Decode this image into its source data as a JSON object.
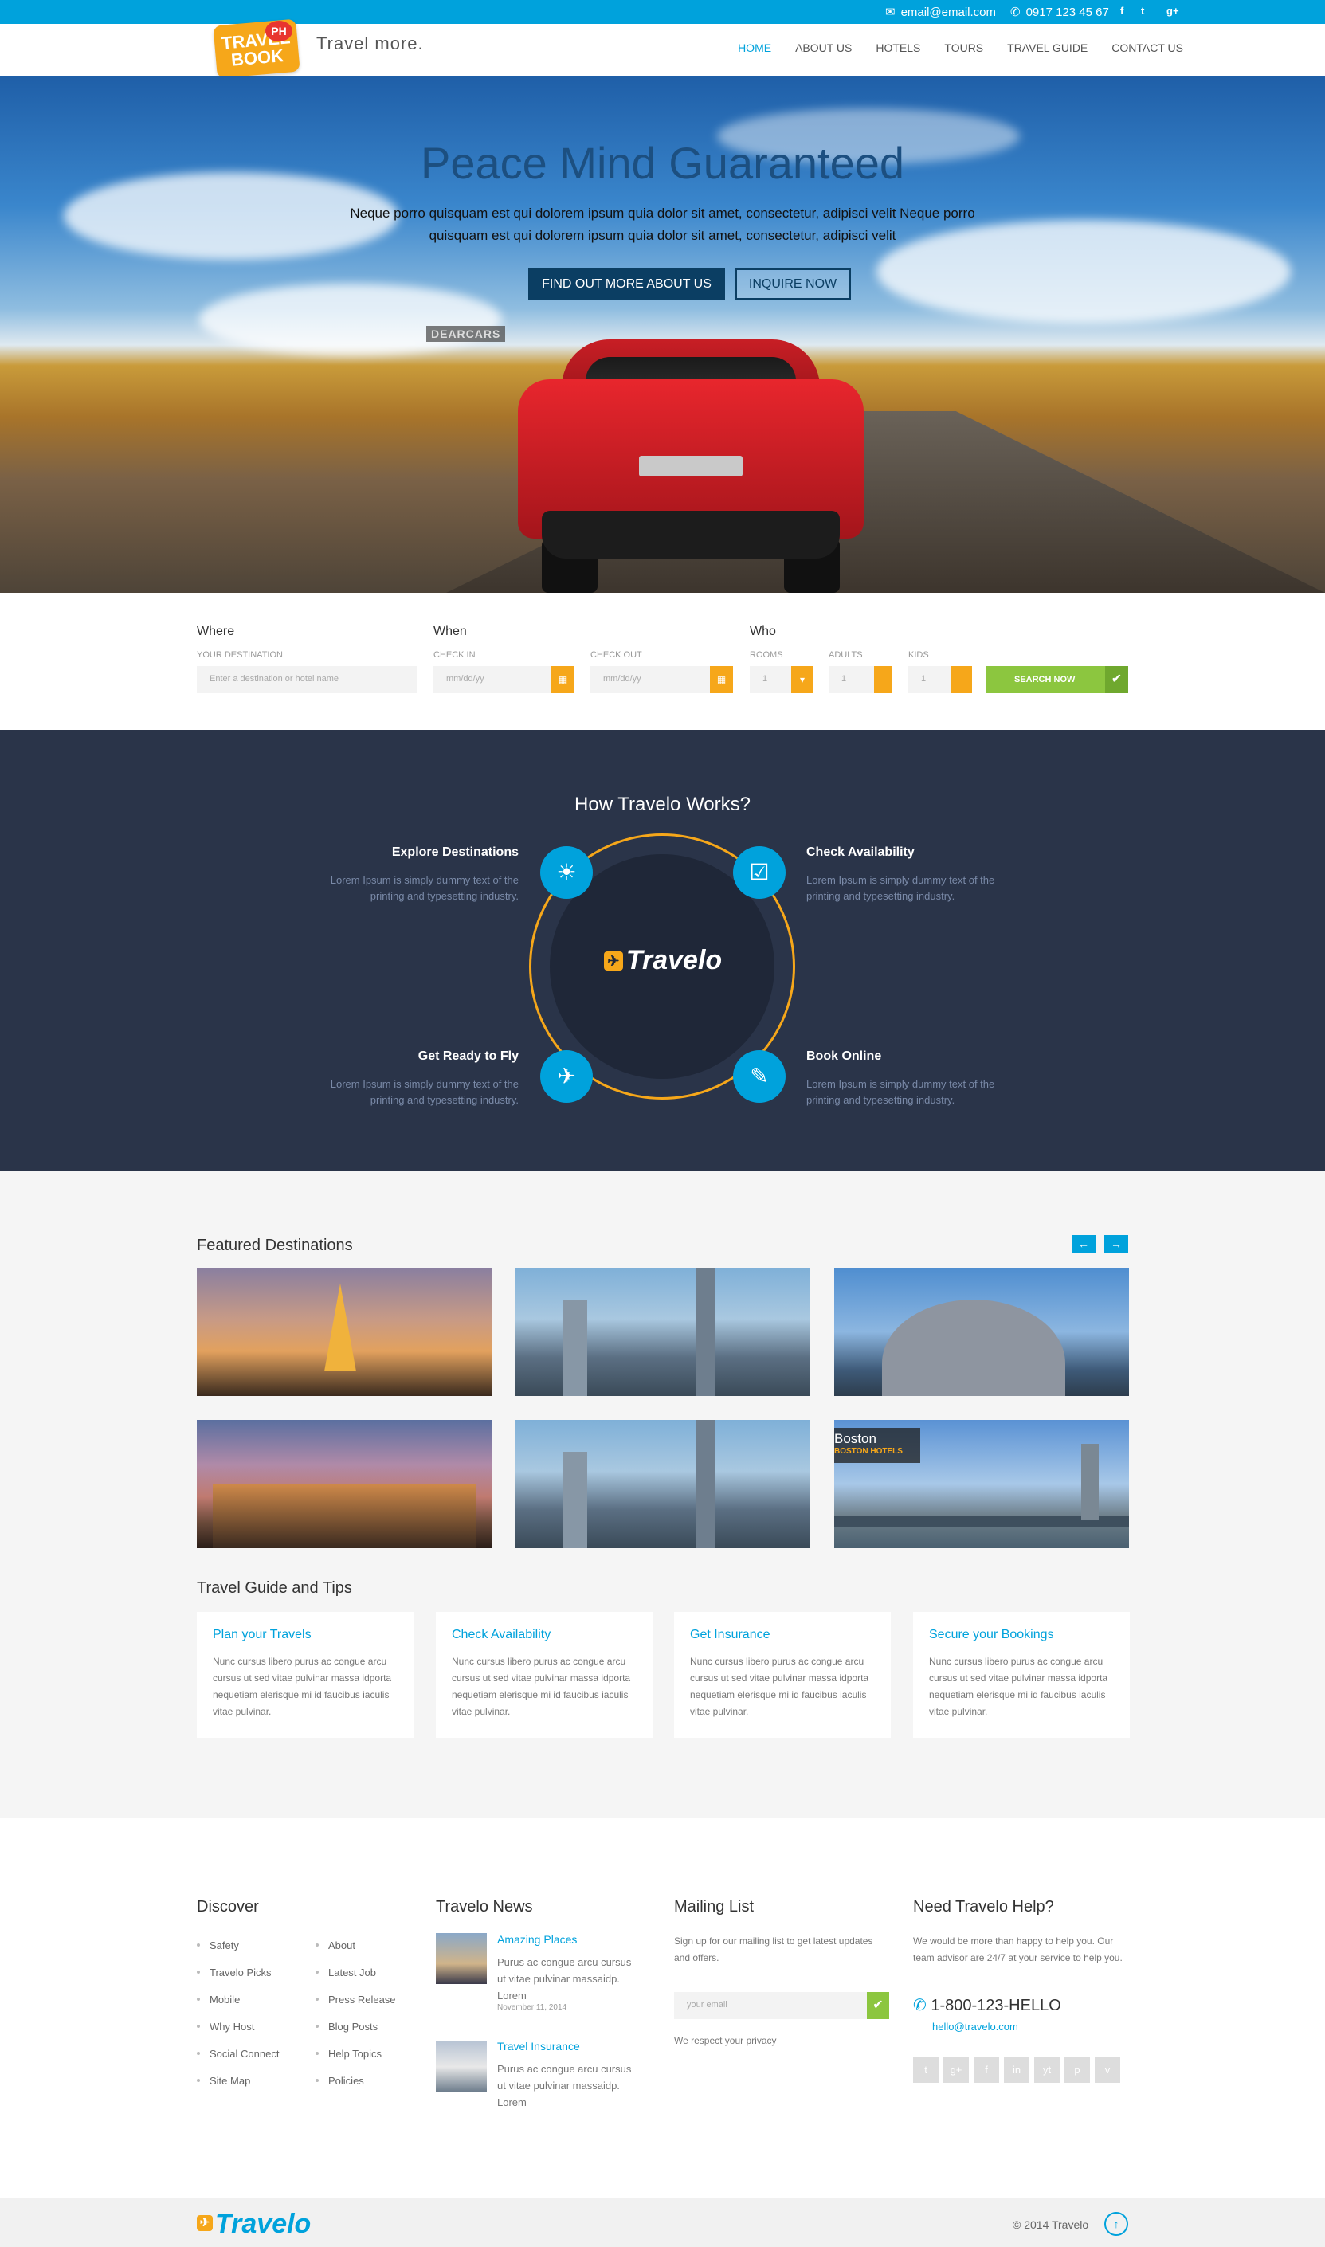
{
  "topbar": {
    "email": "email@email.com",
    "phone": "0917 123 45 67",
    "social": [
      "f",
      "t",
      "g+"
    ]
  },
  "header": {
    "logo_line1": "TRAVEL",
    "logo_line2": "BOOK",
    "logo_badge": "PH",
    "tagline": "Travel more.",
    "nav": [
      "HOME",
      "ABOUT US",
      "HOTELS",
      "TOURS",
      "TRAVEL GUIDE",
      "CONTACT US"
    ]
  },
  "hero": {
    "title": "Peace Mind Guaranteed",
    "text": "Neque porro quisquam est qui dolorem ipsum quia dolor sit amet, consectetur, adipisci velit Neque porro quisquam est qui dolorem ipsum quia dolor sit amet, consectetur, adipisci velit",
    "btn_find": "FIND OUT MORE ABOUT US",
    "btn_inquire": "INQUIRE NOW",
    "watermark": "DEARCARS"
  },
  "search": {
    "where": "Where",
    "when": "When",
    "who": "Who",
    "dest_label": "YOUR DESTINATION",
    "dest_placeholder": "Enter a destination or hotel name",
    "checkin_label": "CHECK IN",
    "checkout_label": "CHECK OUT",
    "date_placeholder": "mm/dd/yy",
    "rooms_label": "ROOMS",
    "adults_label": "ADULTS",
    "kids_label": "KIDS",
    "rooms": "1",
    "adults": "1",
    "kids": "1",
    "button": "SEARCH NOW"
  },
  "how": {
    "title": "How Travelo Works?",
    "logo": "Travelo",
    "steps": [
      {
        "title": "Explore Destinations",
        "text": "Lorem Ipsum is simply dummy text of the printing and typesetting industry."
      },
      {
        "title": "Check Availability",
        "text": "Lorem Ipsum is simply dummy text of the printing and typesetting industry."
      },
      {
        "title": "Get Ready to Fly",
        "text": "Lorem Ipsum is simply dummy text of the printing and typesetting industry."
      },
      {
        "title": "Book Online",
        "text": "Lorem Ipsum is simply dummy text of the printing and typesetting industry."
      }
    ]
  },
  "featured": {
    "title": "Featured Destinations",
    "boston_name": "Boston",
    "boston_sub": "BOSTON HOTELS"
  },
  "tips": {
    "title": "Travel Guide and Tips",
    "items": [
      {
        "title": "Plan your Travels",
        "text": "Nunc cursus libero purus ac congue arcu cursus ut sed vitae pulvinar massa idporta nequetiam elerisque mi id faucibus iaculis vitae pulvinar."
      },
      {
        "title": "Check Availability",
        "text": "Nunc cursus libero purus ac congue arcu cursus ut sed vitae pulvinar massa idporta nequetiam elerisque mi id faucibus iaculis vitae pulvinar."
      },
      {
        "title": "Get Insurance",
        "text": "Nunc cursus libero purus ac congue arcu cursus ut sed vitae pulvinar massa idporta nequetiam elerisque mi id faucibus iaculis vitae pulvinar."
      },
      {
        "title": "Secure your Bookings",
        "text": "Nunc cursus libero purus ac congue arcu cursus ut sed vitae pulvinar massa idporta nequetiam elerisque mi id faucibus iaculis vitae pulvinar."
      }
    ]
  },
  "footer": {
    "discover_title": "Discover",
    "discover_col1": [
      "Safety",
      "Travelo Picks",
      "Mobile",
      "Why Host",
      "Social Connect",
      "Site Map"
    ],
    "discover_col2": [
      "About",
      "Latest Job",
      "Press Release",
      "Blog Posts",
      "Help Topics",
      "Policies"
    ],
    "news_title": "Travelo News",
    "news": [
      {
        "title": "Amazing Places",
        "text": "Purus ac congue arcu cursus ut vitae pulvinar massaidp. Lorem",
        "date": "November 11, 2014"
      },
      {
        "title": "Travel Insurance",
        "text": "Purus ac congue arcu cursus ut vitae pulvinar massaidp. Lorem"
      }
    ],
    "mailing_title": "Mailing List",
    "mailing_text": "Sign up for our mailing list to get latest updates and offers.",
    "mailing_placeholder": "your email",
    "mailing_note": "We respect your privacy",
    "help_title": "Need Travelo Help?",
    "help_text": "We would be more than happy to help you. Our team advisor are 24/7 at your service to help you.",
    "help_phone": "1-800-123-HELLO",
    "help_email": "hello@travelo.com",
    "social": [
      "t",
      "g+",
      "f",
      "in",
      "yt",
      "p",
      "v"
    ]
  },
  "bottom": {
    "logo": "Travelo",
    "copyright": "© 2014 Travelo",
    "top_icon": "↑"
  },
  "colors": {
    "accent": "#00a2dc",
    "orange": "#f6a71a",
    "green": "#8cc63f",
    "dark": "#2a3449"
  }
}
